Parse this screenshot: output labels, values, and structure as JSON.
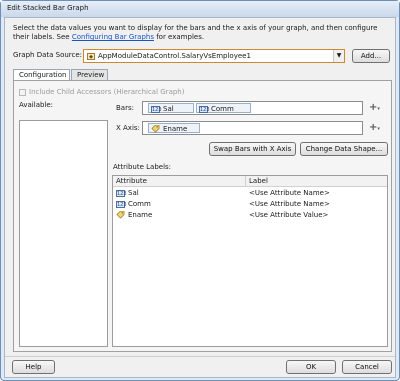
{
  "window": {
    "title": "Edit Stacked Bar Graph"
  },
  "instructions": {
    "text_before_link": "Select the data values you want to display for the bars and the x axis of your graph, and then configure their labels. See ",
    "link": "Configuring Bar Graphs",
    "text_after_link": " for examples."
  },
  "data_source": {
    "label": "Graph Data Source:",
    "value": "AppModuleDataControl.SalaryVsEmployee1",
    "add_button": "Add..."
  },
  "tabs": [
    {
      "label": "Configuration",
      "active": true
    },
    {
      "label": "Preview",
      "active": false
    }
  ],
  "configuration": {
    "include_child_accessors": "Include Child Accessors (Hierarchical Graph)",
    "available_label": "Available:",
    "bars_label": "Bars:",
    "bars": [
      {
        "name": "Sal",
        "icon": "numeric-attribute-icon"
      },
      {
        "name": "Comm",
        "icon": "numeric-attribute-icon"
      }
    ],
    "x_axis_label": "X Axis:",
    "x_axis": [
      {
        "name": "Ename",
        "icon": "tag-attribute-icon"
      }
    ],
    "swap_button": "Swap Bars with X Axis",
    "change_shape_button": "Change Data Shape...",
    "attribute_labels_label": "Attribute Labels:",
    "columns": [
      "Attribute",
      "Label"
    ],
    "rows": [
      {
        "attribute": "Sal",
        "label": "<Use Attribute Name>",
        "icon": "numeric-attribute-icon"
      },
      {
        "attribute": "Comm",
        "label": "<Use Attribute Name>",
        "icon": "numeric-attribute-icon"
      },
      {
        "attribute": "Ename",
        "label": "<Use Attribute Value>",
        "icon": "tag-attribute-icon"
      }
    ]
  },
  "footer": {
    "help": "Help",
    "ok": "OK",
    "cancel": "Cancel"
  },
  "colors": {
    "link": "#1a55c7",
    "combo_border": "#c88a2a",
    "title_bar": "#c9d8ea"
  }
}
